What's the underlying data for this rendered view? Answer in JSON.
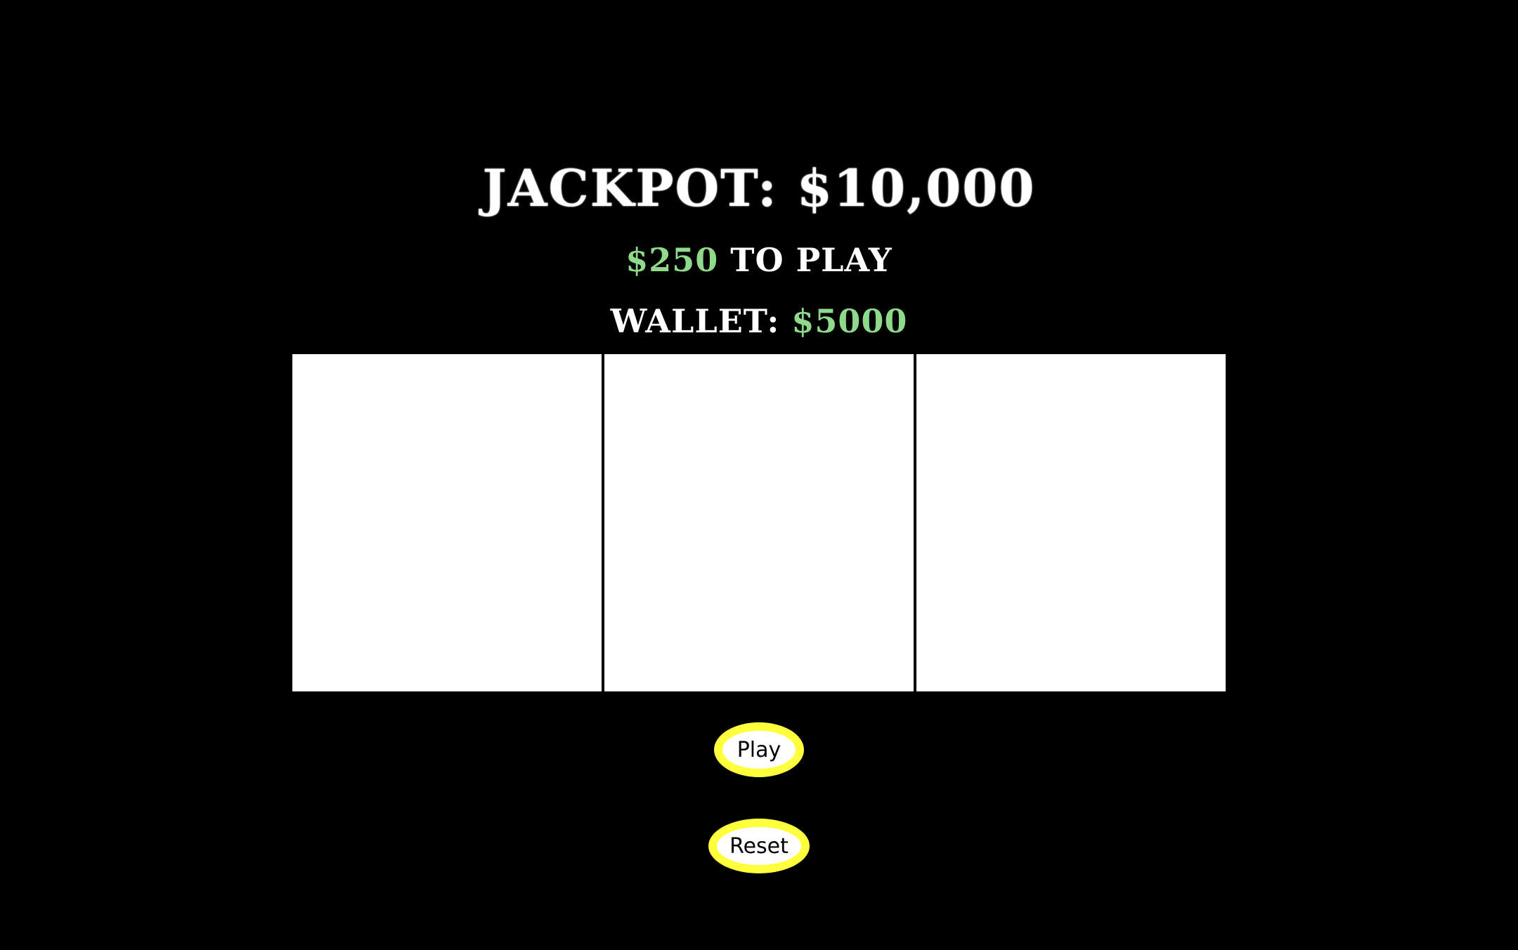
{
  "header": {
    "jackpot_label": "JACKPOT: $10,000",
    "cost_amount": "$250",
    "cost_suffix": " TO PLAY",
    "wallet_label": "WALLET: ",
    "wallet_amount": "$5000"
  },
  "reels": {
    "count": 3,
    "symbols": [
      "",
      "",
      ""
    ]
  },
  "controls": {
    "play_label": "Play",
    "reset_label": "Reset"
  },
  "colors": {
    "background": "#000000",
    "text": "#ffffff",
    "money_green": "#8fd98a",
    "button_ring": "#ffff3d",
    "reel_face": "#ffffff"
  }
}
